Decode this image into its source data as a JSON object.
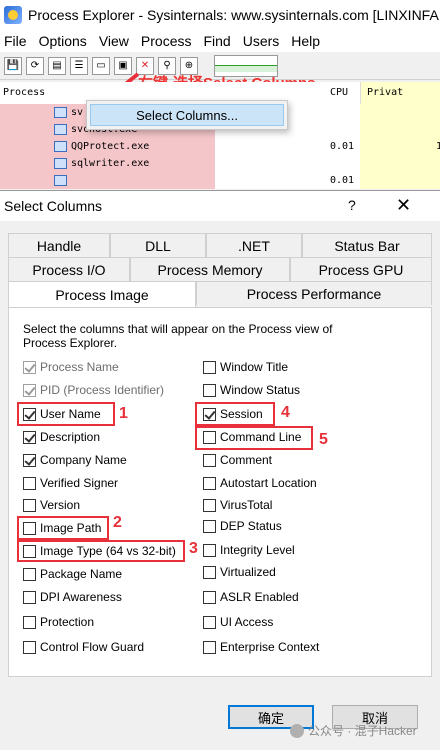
{
  "window": {
    "title": "Process Explorer - Sysinternals: www.sysinternals.com [LINXINFA"
  },
  "menu": [
    "File",
    "Options",
    "View",
    "Process",
    "Find",
    "Users",
    "Help"
  ],
  "process_list": {
    "headers": {
      "process": "Process",
      "cpu": "CPU",
      "private": "Privat"
    },
    "rows": [
      {
        "name": "sv",
        "cpu": "",
        "priv": ""
      },
      {
        "name": "svchost.exe",
        "cpu": "",
        "priv": ""
      },
      {
        "name": "QQProtect.exe",
        "cpu": "0.01",
        "priv": "1"
      },
      {
        "name": "sqlwriter.exe",
        "cpu": "",
        "priv": ""
      },
      {
        "name": "",
        "cpu": "0.01",
        "priv": ""
      }
    ]
  },
  "context_menu": {
    "item": "Select Columns..."
  },
  "annotation": {
    "instruction": "右键-选择Select Columns"
  },
  "dialog": {
    "title": "Select Columns",
    "help": "?",
    "close": "✕",
    "tabs_row1": [
      "Handle",
      "DLL",
      ".NET",
      "Status Bar"
    ],
    "tabs_row2": [
      "Process I/O",
      "Process Memory",
      "Process GPU"
    ],
    "tabs_row3": [
      "Process Image",
      "Process Performance"
    ],
    "description": "Select the columns that will appear on the Process view of Process Explorer.",
    "left_options": [
      {
        "label": "Process Name",
        "checked": true,
        "disabled": true
      },
      {
        "label": "PID (Process Identifier)",
        "checked": true,
        "disabled": true
      },
      {
        "label": "User Name",
        "checked": true,
        "disabled": false
      },
      {
        "label": "Description",
        "checked": true,
        "disabled": false
      },
      {
        "label": "Company Name",
        "checked": true,
        "disabled": false
      },
      {
        "label": "Verified Signer",
        "checked": false,
        "disabled": false
      },
      {
        "label": "Version",
        "checked": false,
        "disabled": false
      },
      {
        "label": "Image Path",
        "checked": false,
        "disabled": false
      },
      {
        "label": "Image Type (64 vs 32-bit)",
        "checked": false,
        "disabled": false
      },
      {
        "label": "Package Name",
        "checked": false,
        "disabled": false
      },
      {
        "label": "DPI Awareness",
        "checked": false,
        "disabled": false
      },
      {
        "label": "Protection",
        "checked": false,
        "disabled": false
      },
      {
        "label": "Control Flow Guard",
        "checked": false,
        "disabled": false
      }
    ],
    "right_options": [
      {
        "label": "Window Title",
        "checked": false
      },
      {
        "label": "Window Status",
        "checked": false
      },
      {
        "label": "Session",
        "checked": true
      },
      {
        "label": "Command Line",
        "checked": false
      },
      {
        "label": "Comment",
        "checked": false
      },
      {
        "label": "Autostart Location",
        "checked": false
      },
      {
        "label": "VirusTotal",
        "checked": false
      },
      {
        "label": "DEP Status",
        "checked": false
      },
      {
        "label": "Integrity Level",
        "checked": false
      },
      {
        "label": "Virtualized",
        "checked": false
      },
      {
        "label": "ASLR Enabled",
        "checked": false
      },
      {
        "label": "UI Access",
        "checked": false
      },
      {
        "label": "Enterprise Context",
        "checked": false
      }
    ],
    "ok": "确定",
    "cancel": "取消"
  },
  "markers": [
    "1",
    "2",
    "3",
    "4",
    "5"
  ],
  "watermark": "公众号 · 混子Hacker",
  "colors": {
    "highlight_red": "#e8303a",
    "accent_blue": "#0078d7"
  }
}
